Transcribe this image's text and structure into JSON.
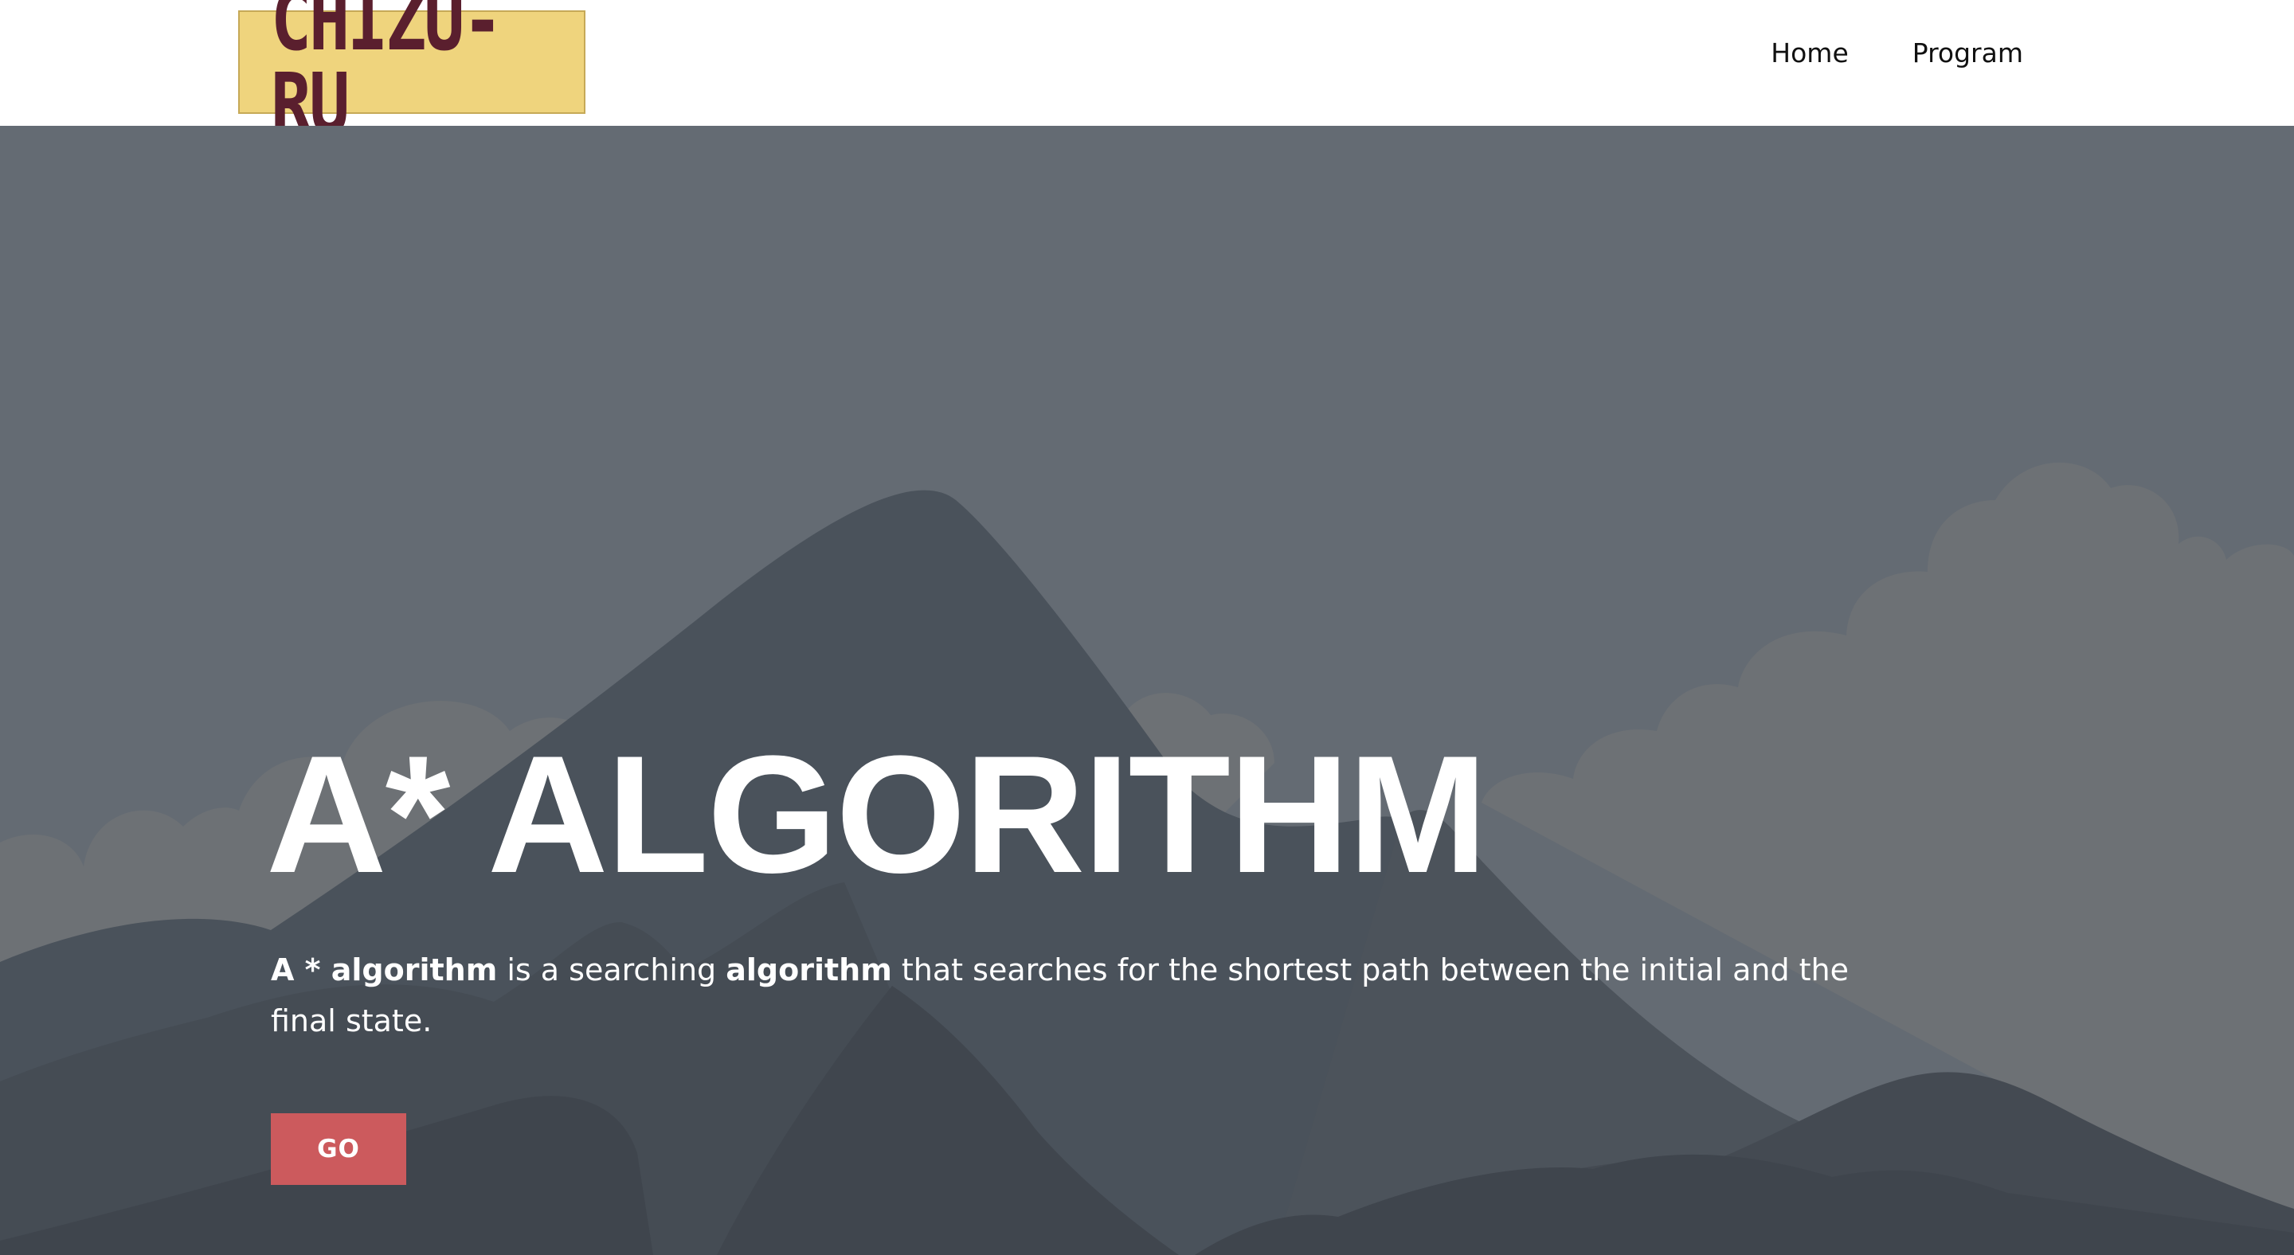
{
  "header": {
    "logo_text": "CHIZU-RU",
    "nav": [
      {
        "label": "Home"
      },
      {
        "label": "Program"
      }
    ]
  },
  "hero": {
    "title": "A* ALGORITHM",
    "description": {
      "part1_bold": "A * algorithm",
      "part2": " is a searching ",
      "part3_bold": "algorithm",
      "part4": " that searches for the shortest path between the initial and the final state."
    },
    "button_label": "GO"
  },
  "colors": {
    "header_bg": "#ffffff",
    "logo_bg": "#efd47d",
    "logo_text": "#5a1f2e",
    "hero_sky": "#646b73",
    "button_bg": "#cc5a5d"
  }
}
